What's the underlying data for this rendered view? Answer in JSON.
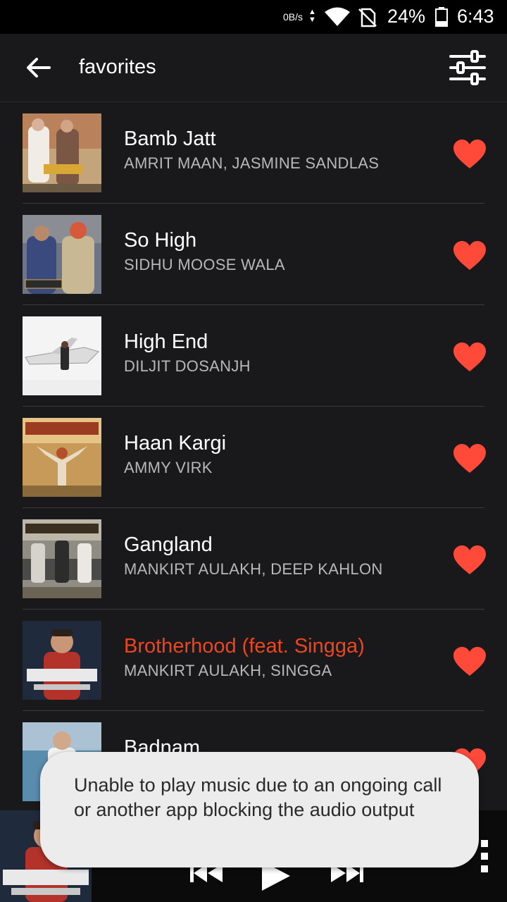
{
  "status_bar": {
    "net_speed": "0B/s",
    "battery_percent": "24%",
    "time": "6:43",
    "icons": [
      "wifi-icon",
      "no-sim-icon",
      "battery-icon"
    ]
  },
  "header": {
    "back_icon": "arrow-back-icon",
    "title": "favorites",
    "equalizer_icon": "equalizer-icon"
  },
  "songs": [
    {
      "title": "Bamb Jatt",
      "artist": "AMRIT MAAN, JASMINE SANDLAS",
      "favorite": true,
      "playing": false
    },
    {
      "title": "So High",
      "artist": "SIDHU MOOSE WALA",
      "favorite": true,
      "playing": false
    },
    {
      "title": "High End",
      "artist": "DILJIT DOSANJH",
      "favorite": true,
      "playing": false
    },
    {
      "title": "Haan Kargi",
      "artist": "AMMY VIRK",
      "favorite": true,
      "playing": false
    },
    {
      "title": "Gangland",
      "artist": "MANKIRT AULAKH, DEEP KAHLON",
      "favorite": true,
      "playing": false
    },
    {
      "title": "Brotherhood (feat. Singga)",
      "artist": "MANKIRT AULAKH, SINGGA",
      "favorite": true,
      "playing": true
    },
    {
      "title": "Badnam",
      "artist": "",
      "favorite": true,
      "playing": false
    }
  ],
  "player": {
    "controls": [
      "previous-icon",
      "play-icon",
      "next-icon",
      "more-vert-icon"
    ]
  },
  "toast": {
    "message": "Unable to play music due to an ongoing call or another app blocking the audio output"
  },
  "colors": {
    "background": "#19191b",
    "accent": "#f0441f",
    "heart": "#ff4a3a",
    "toast_bg": "#ececec"
  }
}
